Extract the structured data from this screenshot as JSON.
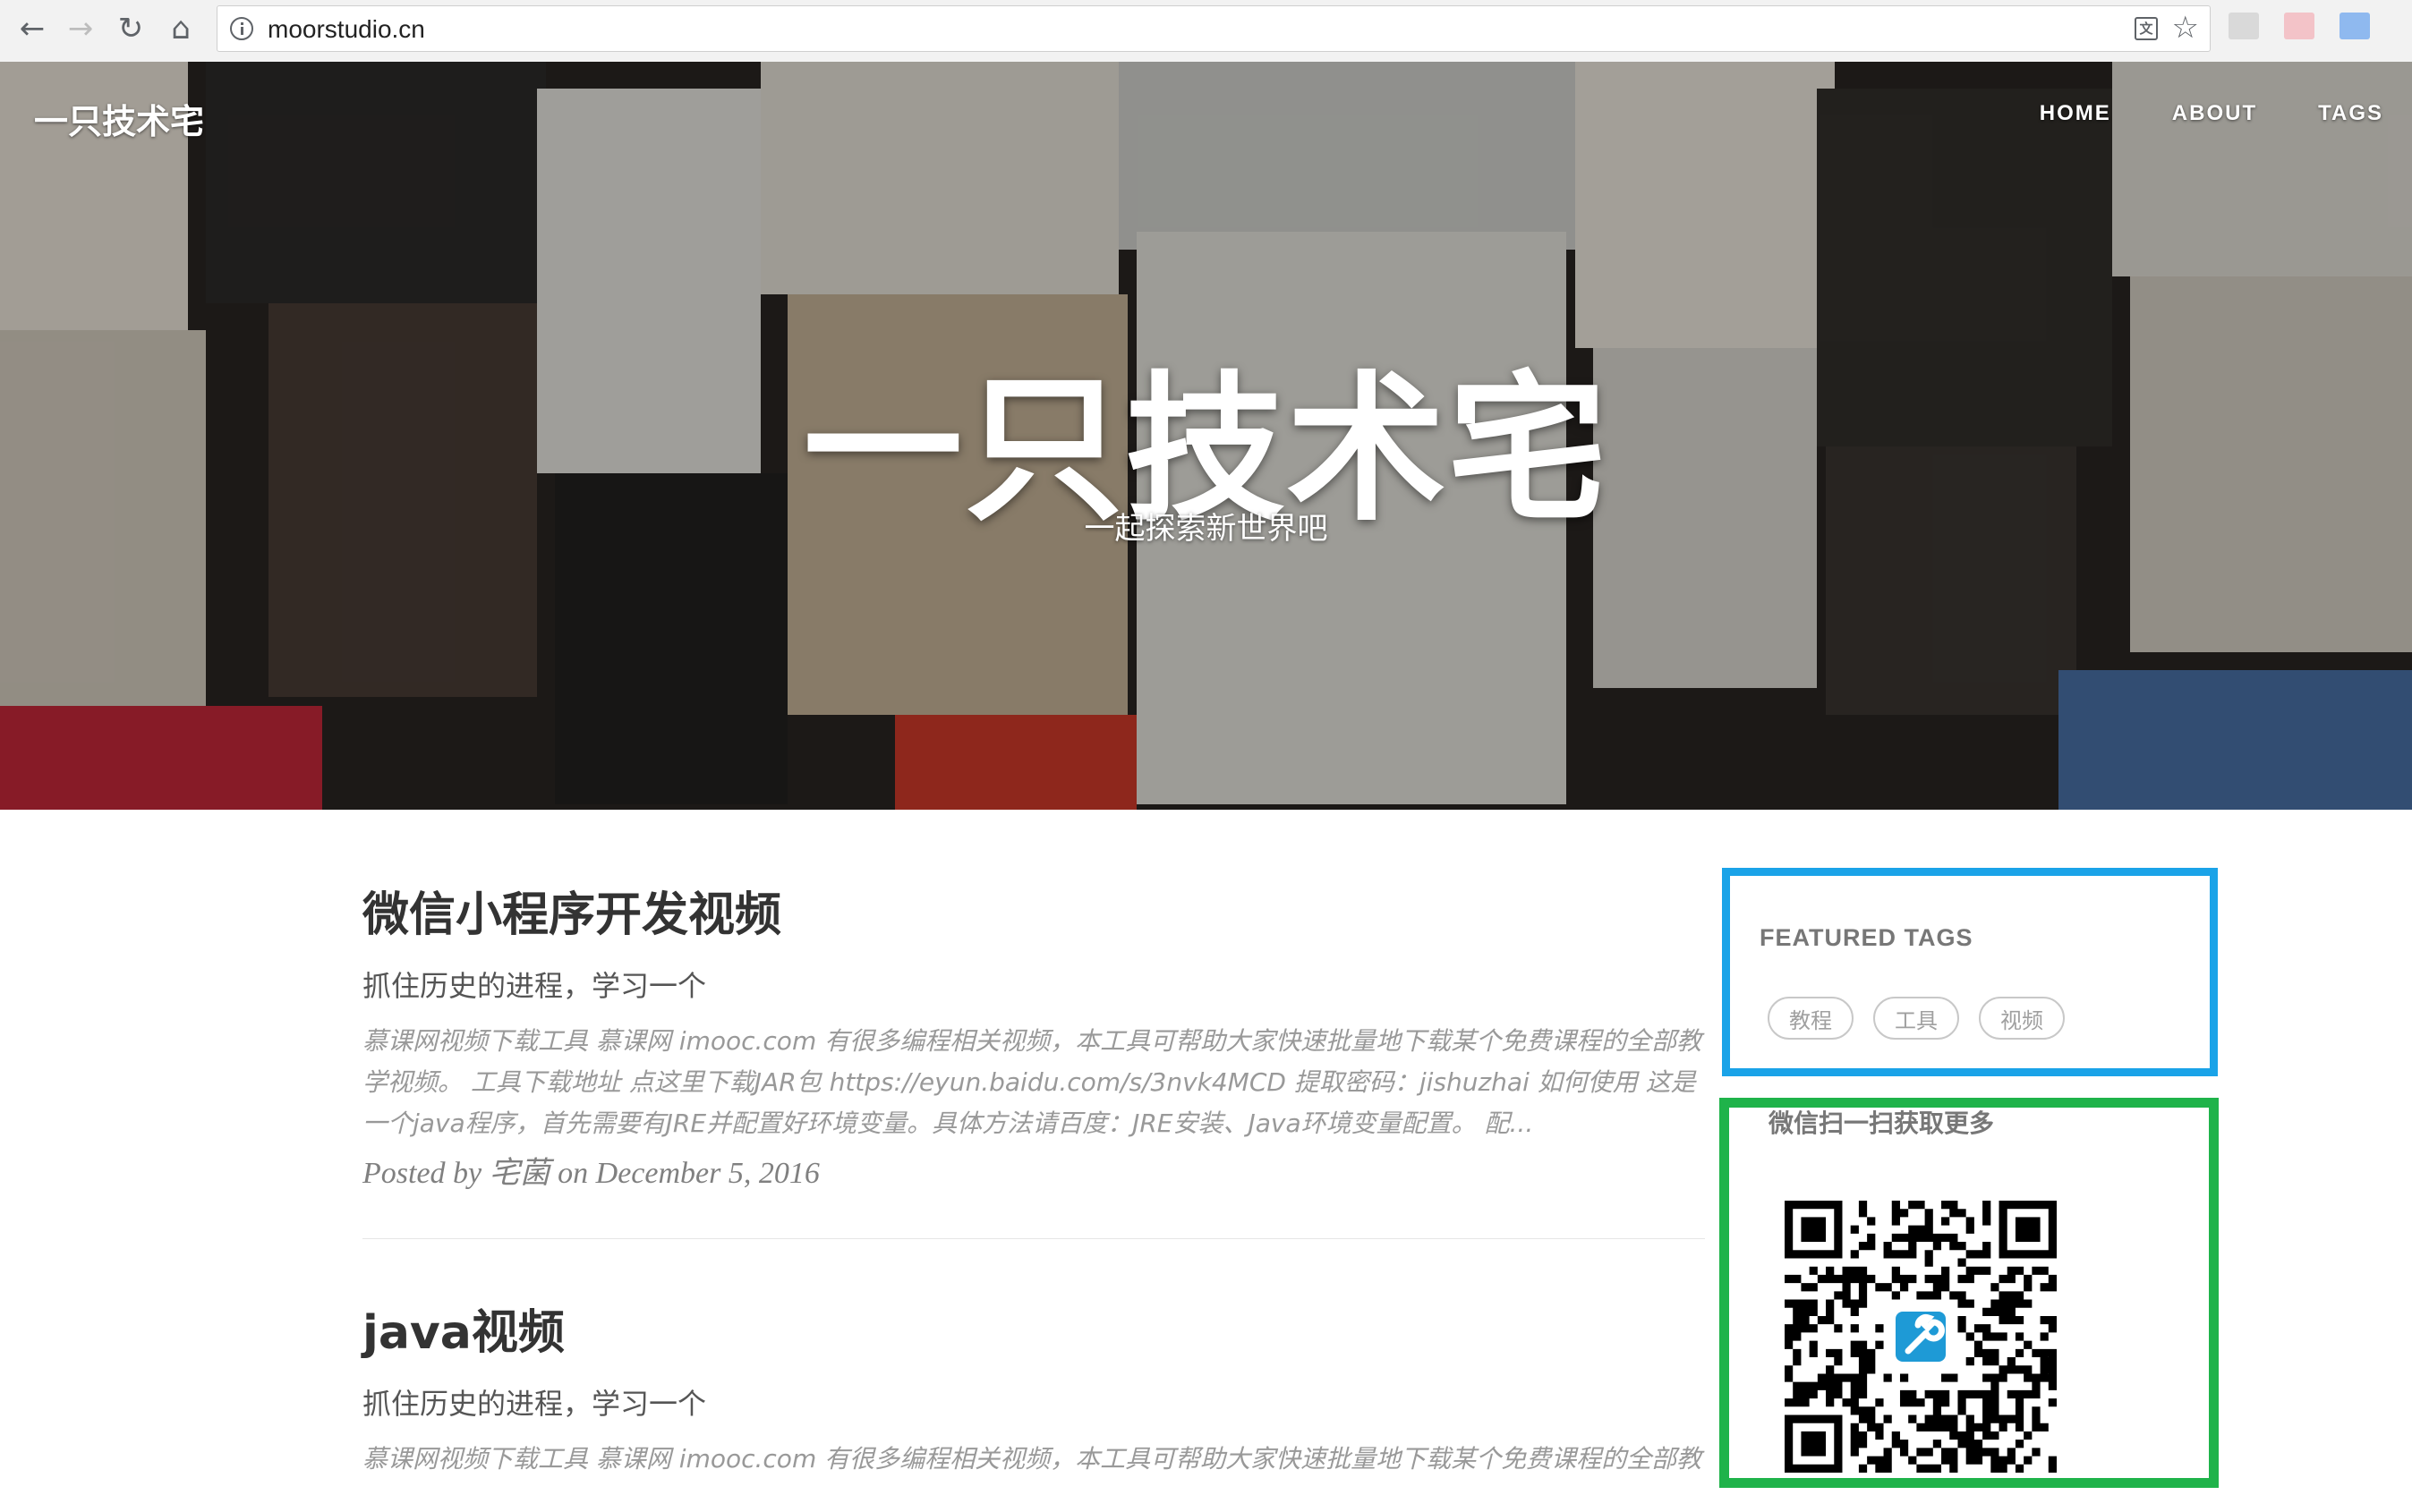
{
  "browser": {
    "url": "moorstudio.cn",
    "back_icon": "←",
    "forward_icon": "→",
    "reload_icon": "↻",
    "home_icon": "⌂",
    "translate_icon": "文",
    "star_icon": "☆"
  },
  "site": {
    "brand": "一只技术宅",
    "nav": [
      "HOME",
      "ABOUT",
      "TAGS"
    ],
    "hero_title": "一只技术宅",
    "hero_subtitle": "一起探索新世界吧"
  },
  "posts": [
    {
      "title": "微信小程序开发视频",
      "subtitle": "抓住历史的进程，学习一个",
      "excerpt": "慕课网视频下载工具 慕课网 imooc.com 有很多编程相关视频，本工具可帮助大家快速批量地下载某个免费课程的全部教学视频。 工具下载地址 点这里下载JAR包 https://eyun.baidu.com/s/3nvk4MCD 提取密码：jishuzhai 如何使用 这是一个java程序，首先需要有JRE并配置好环境变量。具体方法请百度：JRE安装、Java环境变量配置。 配...",
      "meta_prefix": "Posted by",
      "author": "宅菌",
      "meta_on": "on",
      "date": "December 5, 2016"
    },
    {
      "title": "java视频",
      "subtitle": "抓住历史的进程，学习一个",
      "excerpt": "慕课网视频下载工具 慕课网 imooc.com 有很多编程相关视频，本工具可帮助大家快速批量地下载某个免费课程的全部教"
    }
  ],
  "sidebar": {
    "featured_tags_heading": "FEATURED TAGS",
    "tags": [
      "教程",
      "工具",
      "视频"
    ],
    "qr_heading": "微信扫一扫获取更多"
  },
  "colors": {
    "tags_box_border": "#1aa3e8",
    "qr_box_border": "#1fb34a",
    "qr_logo": "#1e9ad6"
  }
}
